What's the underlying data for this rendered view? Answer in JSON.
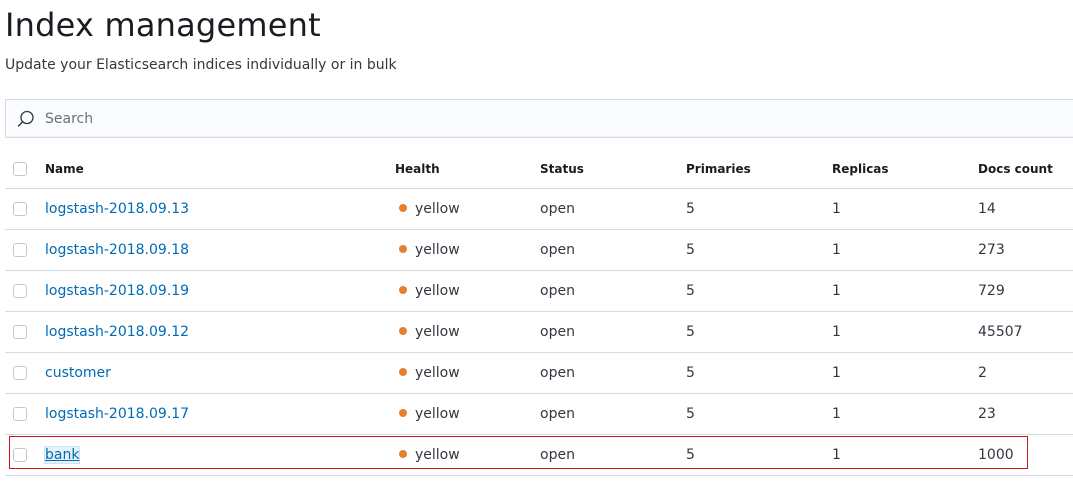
{
  "page": {
    "title": "Index management",
    "subtitle": "Update your Elasticsearch indices individually or in bulk"
  },
  "search": {
    "placeholder": "Search",
    "value": "",
    "icon": "search-icon"
  },
  "table": {
    "columns": {
      "name": "Name",
      "health": "Health",
      "status": "Status",
      "primaries": "Primaries",
      "replicas": "Replicas",
      "docs_count": "Docs count"
    },
    "rows": [
      {
        "name": "logstash-2018.09.13",
        "health": "yellow",
        "status": "open",
        "primaries": "5",
        "replicas": "1",
        "docs_count": "14"
      },
      {
        "name": "logstash-2018.09.18",
        "health": "yellow",
        "status": "open",
        "primaries": "5",
        "replicas": "1",
        "docs_count": "273"
      },
      {
        "name": "logstash-2018.09.19",
        "health": "yellow",
        "status": "open",
        "primaries": "5",
        "replicas": "1",
        "docs_count": "729"
      },
      {
        "name": "logstash-2018.09.12",
        "health": "yellow",
        "status": "open",
        "primaries": "5",
        "replicas": "1",
        "docs_count": "45507"
      },
      {
        "name": "customer",
        "health": "yellow",
        "status": "open",
        "primaries": "5",
        "replicas": "1",
        "docs_count": "2"
      },
      {
        "name": "logstash-2018.09.17",
        "health": "yellow",
        "status": "open",
        "primaries": "5",
        "replicas": "1",
        "docs_count": "23"
      },
      {
        "name": "bank",
        "health": "yellow",
        "status": "open",
        "primaries": "5",
        "replicas": "1",
        "docs_count": "1000"
      }
    ]
  },
  "colors": {
    "health_yellow": "#e7802b",
    "link": "#006bb4",
    "highlight_border": "#c9181e"
  }
}
